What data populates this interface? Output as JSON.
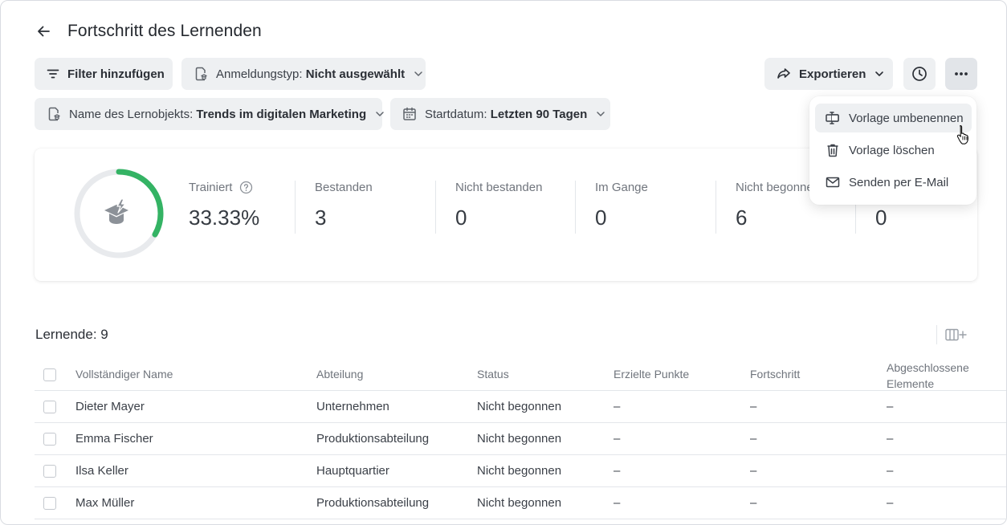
{
  "header": {
    "title": "Fortschritt des Lernenden"
  },
  "filters": {
    "add_filter": "Filter hinzufügen",
    "registration_label": "Anmeldungstyp:",
    "registration_value": "Nicht ausgewählt",
    "object_label": "Name des Lernobjekts:",
    "object_value": "Trends im digitalen Marketing",
    "start_label": "Startdatum:",
    "start_value": "Letzten 90 Tagen"
  },
  "toolbar": {
    "export_label": "Exportieren"
  },
  "stats": {
    "trained_label": "Trainiert",
    "trained_value": "33.33%",
    "trained_fraction": 0.3333,
    "passed_label": "Bestanden",
    "passed_value": "3",
    "failed_label": "Nicht bestanden",
    "failed_value": "0",
    "inprogress_label": "Im Gange",
    "inprogress_value": "0",
    "notstarted_label": "Nicht begonnen",
    "notstarted_value": "6",
    "last_value": "0",
    "accent_color": "#34b364"
  },
  "menu": {
    "items": [
      {
        "label": "Vorlage umbenennen",
        "icon": "rename-icon"
      },
      {
        "label": "Vorlage löschen",
        "icon": "trash-icon"
      },
      {
        "label": "Senden per E-Mail",
        "icon": "mail-icon"
      }
    ]
  },
  "table": {
    "count_label": "Lernende: 9",
    "columns": [
      "Vollständiger Name",
      "Abteilung",
      "Status",
      "Erzielte Punkte",
      "Fortschritt",
      "Abgeschlossene",
      "Elemente"
    ],
    "rows": [
      {
        "name": "Dieter Mayer",
        "dept": "Unternehmen",
        "status": "Nicht begonnen",
        "points": "–",
        "progress": "–",
        "completed": "–"
      },
      {
        "name": "Emma Fischer",
        "dept": "Produktionsabteilung",
        "status": "Nicht begonnen",
        "points": "–",
        "progress": "–",
        "completed": "–"
      },
      {
        "name": "Ilsa Keller",
        "dept": "Hauptquartier",
        "status": "Nicht begonnen",
        "points": "–",
        "progress": "–",
        "completed": "–"
      },
      {
        "name": "Max Müller",
        "dept": "Produktionsabteilung",
        "status": "Nicht begonnen",
        "points": "–",
        "progress": "–",
        "completed": "–"
      }
    ]
  }
}
